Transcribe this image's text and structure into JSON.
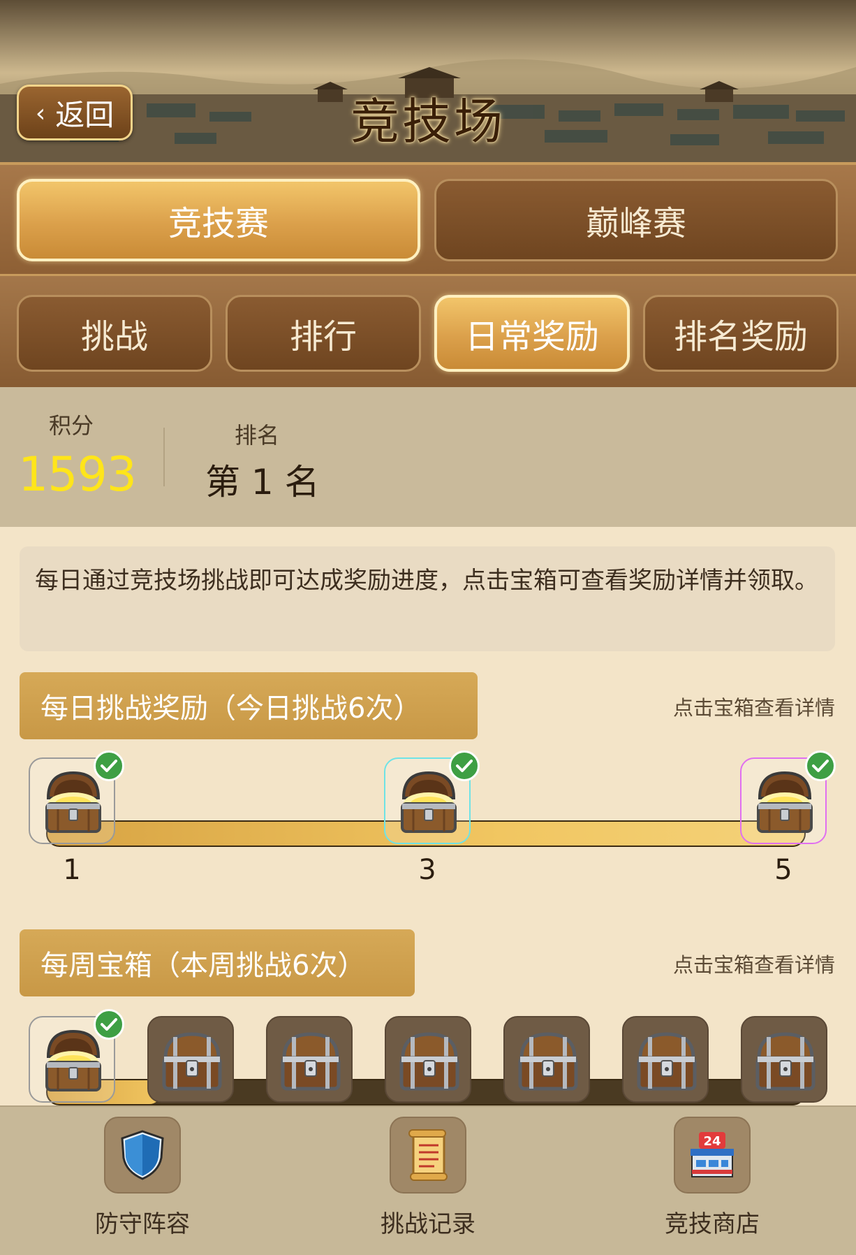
{
  "header": {
    "back_label": "返回",
    "title": "竞技场"
  },
  "mode_tabs": [
    {
      "label": "竞技赛",
      "active": true
    },
    {
      "label": "巅峰赛",
      "active": false
    }
  ],
  "sub_tabs": [
    {
      "label": "挑战",
      "active": false
    },
    {
      "label": "排行",
      "active": false
    },
    {
      "label": "日常奖励",
      "active": true
    },
    {
      "label": "排名奖励",
      "active": false
    }
  ],
  "stats": {
    "score_label": "积分",
    "score_value": "1593",
    "rank_label": "排名",
    "rank_value": "第 1 名"
  },
  "info_text": "每日通过竞技场挑战即可达成奖励进度，点击宝箱可查看奖励详情并领取。",
  "daily": {
    "title": "每日挑战奖励（今日挑战6次）",
    "hint": "点击宝箱查看详情",
    "progress": 1.0,
    "chests": [
      {
        "milestone": "1",
        "claimed": true,
        "frame_color": "#9a9a9a"
      },
      {
        "milestone": "3",
        "claimed": true,
        "frame_color": "#6fe3e6"
      },
      {
        "milestone": "5",
        "claimed": true,
        "frame_color": "#e070f0"
      }
    ]
  },
  "weekly": {
    "title": "每周宝箱（本周挑战6次）",
    "hint": "点击宝箱查看详情",
    "progress": 0.15,
    "chests": [
      {
        "claimed": true
      },
      {
        "claimed": false
      },
      {
        "claimed": false
      },
      {
        "claimed": false
      },
      {
        "claimed": false
      },
      {
        "claimed": false
      },
      {
        "claimed": false
      }
    ]
  },
  "bottom_nav": [
    {
      "label": "防守阵容",
      "icon": "shield-icon"
    },
    {
      "label": "挑战记录",
      "icon": "scroll-icon"
    },
    {
      "label": "竞技商店",
      "icon": "shop-icon",
      "badge": "24"
    }
  ]
}
